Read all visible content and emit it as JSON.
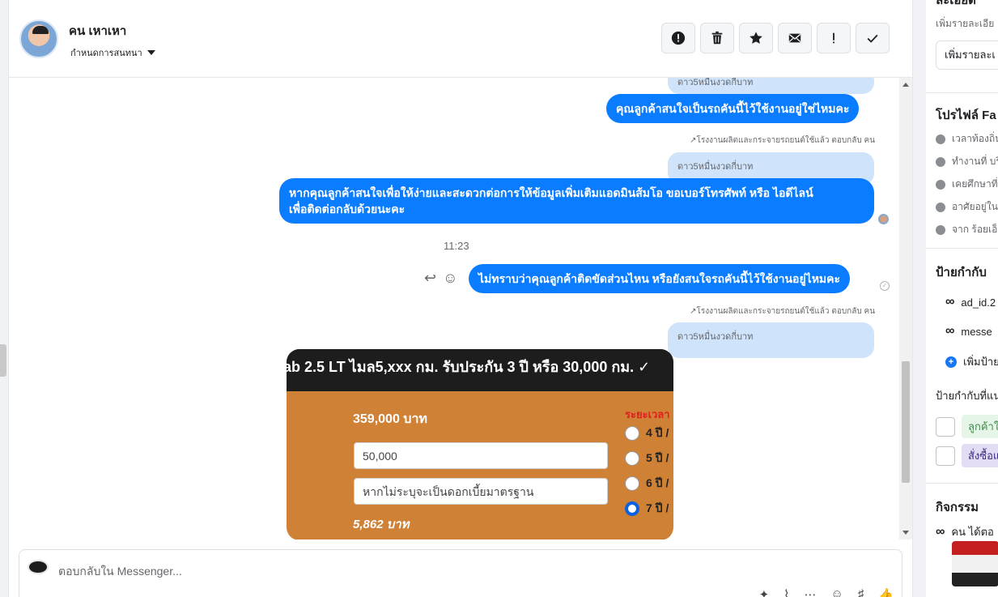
{
  "header": {
    "contact_name": "คน เหาเหา",
    "assign_label": "กำหนดการสนทนา",
    "actions": [
      {
        "name": "spam-button",
        "icon": "alert-circle-icon"
      },
      {
        "name": "delete-button",
        "icon": "trash-icon"
      },
      {
        "name": "star-button",
        "icon": "star-icon"
      },
      {
        "name": "mark-unread-button",
        "icon": "envelope-icon"
      },
      {
        "name": "follow-up-button",
        "icon": "exclamation-icon"
      },
      {
        "name": "mark-done-button",
        "icon": "check-icon"
      }
    ]
  },
  "thread": {
    "reply_pill_1": "ดาว5หมื่นงวดกี่บาท",
    "msg_1": "คุณลูกค้าสนใจเป็นรถคันนี้ไว้ใช้งานอยู่ใช่ไหมคะ",
    "reply_note_1": "↗โรงงานผลิตและกระจายรถยนต์ใช้แล้ว ตอบกลับ คน",
    "reply_pill_2": "ดาว5หมื่นงวดกี่บาท",
    "msg_2_line1": "หากคุณลูกค้าสนใจเพื่อให้ง่ายและสะดวกต่อการให้ข้อมูลเพิ่มเติมแอดมินส้มโอ ขอเบอร์โทรศัพท์ หรือ ไอดีไลน์",
    "msg_2_line2": "เพื่อติดต่อกลับด้วยนะคะ",
    "time": "11:23",
    "msg_3": "ไม่ทราบว่าคุณลูกค้าติดขัดส่วนไหน หรือยังสนใจรถคันนี้ไว้ใช้งานอยู่ไหมคะ",
    "reply_note_2": "↗โรงงานผลิตและกระจายรถยนต์ใช้แล้ว ตอบกลับ คน",
    "reply_pill_3": "ดาว5หมื่นงวดกี่บาท",
    "image": {
      "banner": "ab 2.5 LT ไมล5,xxx กม. รับประกัน 3 ปี หรือ 30,000 กม. ✓",
      "price": "359,000 บาท",
      "down_payment": "50,000",
      "interest_placeholder": "หากไม่ระบุจะเป็นดอกเบี้ยมาตรฐาน",
      "monthly": "5,862 บาท",
      "period_label": "ระยะเวลา",
      "options": [
        "4 ปี /",
        "5 ปี /",
        "6 ปี /",
        "7 ปี /"
      ],
      "selected_option_index": 3
    }
  },
  "composer": {
    "placeholder": "ตอบกลับใน Messenger..."
  },
  "sidebar": {
    "details_title": "ละเอียด",
    "details_sub": "เพิ่มรายละเอีย",
    "details_button": "เพิ่มรายละเ",
    "profile_title": "โปรไฟล์ Fa",
    "profile_rows": [
      "เวลาท้องถิ่น",
      "ทำงานที่ บริ",
      "เคยศึกษาที่",
      "อาศัยอยู่ใน",
      "จาก ร้อยเอ็ด"
    ],
    "tags_title": "ป้ายกำกับ",
    "tags": [
      "ad_id.2",
      "messe"
    ],
    "add_tag": "เพิ่มป้าย",
    "suggested_title": "ป้ายกำกับที่แน",
    "suggested": [
      "ลูกค้าใ",
      "สั่งซื้อแ"
    ],
    "activity_title": "กิจกรรม",
    "activity_row": "คน ได้ตอ",
    "colors": {
      "accent": "#0a7cff",
      "reply_pill": "#cfe3fb",
      "chip_green_bg": "#e5f5e8",
      "chip_purple_bg": "#e2dcf5"
    }
  }
}
